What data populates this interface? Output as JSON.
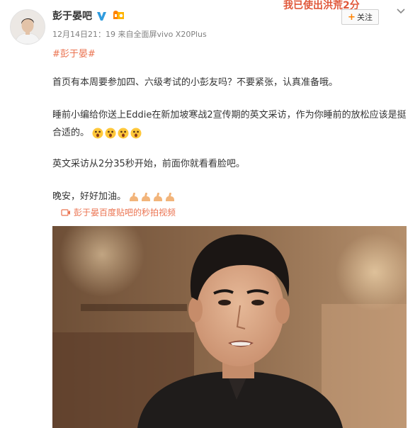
{
  "user": {
    "name": "彭于晏吧",
    "timestamp": "12月14日21：19",
    "source_prefix": "来自",
    "source": "全面屏vivo X20Plus"
  },
  "header": {
    "decoration_text": "我已使出洪荒2分",
    "follow_label": "关注"
  },
  "post": {
    "topic": "#彭于晏#",
    "paragraphs": [
      "首页有本周要参加四、六级考试的小彭友吗？不要紧张，认真准备哦。",
      "睡前小编给你送上Eddie在新加坡寒战2宣传期的英文采访，作为你睡前的放松应该是挺合适的。",
      "英文采访从2分35秒开始，前面你就看看脸吧。",
      "晚安，好好加油。"
    ],
    "video_link": "彭于晏百度贴吧的秒拍视频"
  },
  "icons": {
    "verified": "verified-v-icon",
    "level": "vip-level-icon",
    "caret": "chevron-down-icon",
    "video": "video-icon",
    "surprised": "surprised-emoji",
    "strong": "flex-arm-emoji"
  },
  "colors": {
    "link": "#eb7350",
    "verified": "#2f9bde",
    "level": "#ff8200"
  }
}
